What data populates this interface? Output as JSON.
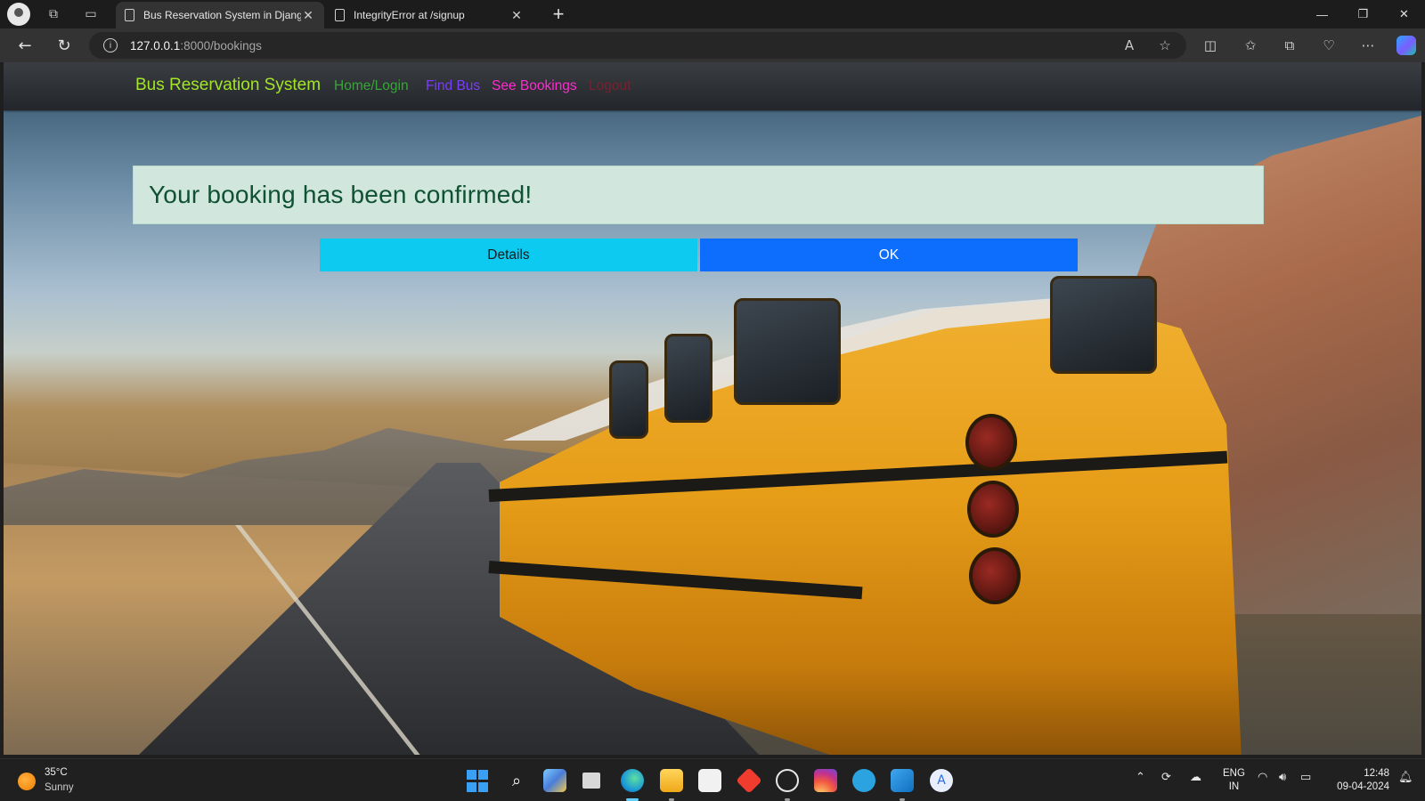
{
  "browser": {
    "tabs": [
      {
        "title": "Bus Reservation System in Djang",
        "active": true
      },
      {
        "title": "IntegrityError at /signup",
        "active": false
      }
    ],
    "new_tab_symbol": "+",
    "url_host": "127.0.0.1",
    "url_rest": ":8000/bookings",
    "window_controls": {
      "minimize": "—",
      "restore": "❐",
      "close": "✕"
    }
  },
  "site": {
    "brand": "Bus Reservation System",
    "nav": [
      {
        "label": "Home/Login",
        "color": "#3aa53a"
      },
      {
        "label": "Find Bus",
        "color": "#7a3cff"
      },
      {
        "label": "See Bookings",
        "color": "#ff2bd0"
      },
      {
        "label": "Logout",
        "color": "#7a2030"
      }
    ],
    "alert_message": "Your booking has been confirmed!",
    "buttons": {
      "details": "Details",
      "ok": "OK"
    },
    "colors": {
      "brand": "#a2e626",
      "alert_bg": "#d1e7dd",
      "alert_text": "#0f5132",
      "details_bg": "#0dcaf0",
      "ok_bg": "#0d6efd"
    }
  },
  "taskbar": {
    "weather": {
      "temp": "35°C",
      "condition": "Sunny"
    },
    "apps": [
      "windows-start-icon",
      "search-icon",
      "widgets-icon",
      "task-view-icon",
      "edge-icon",
      "file-explorer-icon",
      "microsoft-store-icon",
      "git-icon",
      "whatsapp-icon",
      "instagram-icon",
      "telegram-icon",
      "vscode-icon",
      "assistant-icon"
    ],
    "language": {
      "line1": "ENG",
      "line2": "IN"
    },
    "clock": {
      "time": "12:48",
      "date": "09-04-2024"
    }
  }
}
